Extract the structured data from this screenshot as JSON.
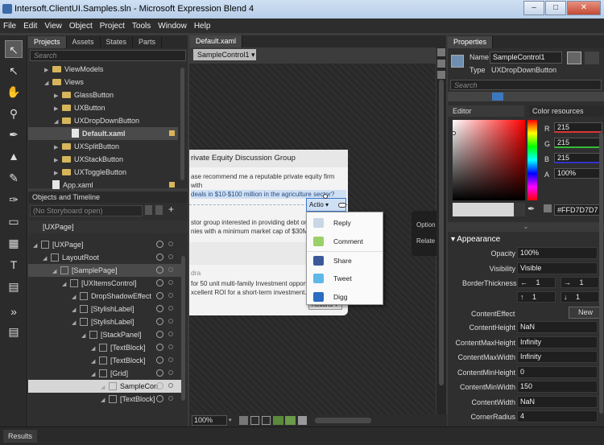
{
  "window": {
    "title": "Intersoft.ClientUI.Samples.sln - Microsoft Expression Blend 4"
  },
  "menu": [
    "File",
    "Edit",
    "View",
    "Object",
    "Project",
    "Tools",
    "Window",
    "Help"
  ],
  "projects_panel": {
    "tabs": [
      "Projects",
      "Assets",
      "States",
      "Parts"
    ],
    "search_placeholder": "Search",
    "tree": [
      {
        "label": "ViewModels",
        "level": 1,
        "kind": "folder",
        "expanded": false
      },
      {
        "label": "Views",
        "level": 1,
        "kind": "folder",
        "expanded": true
      },
      {
        "label": "GlassButton",
        "level": 2,
        "kind": "folder",
        "expanded": false
      },
      {
        "label": "UXButton",
        "level": 2,
        "kind": "folder",
        "expanded": false
      },
      {
        "label": "UXDropDownButton",
        "level": 2,
        "kind": "folder",
        "expanded": true
      },
      {
        "label": "Default.xaml",
        "level": 3,
        "kind": "file",
        "selected": true
      },
      {
        "label": "UXSplitButton",
        "level": 2,
        "kind": "folder",
        "expanded": false
      },
      {
        "label": "UXStackButton",
        "level": 2,
        "kind": "folder",
        "expanded": false
      },
      {
        "label": "UXToggleButton",
        "level": 2,
        "kind": "folder",
        "expanded": false
      },
      {
        "label": "App.xaml",
        "level": 1,
        "kind": "file"
      }
    ]
  },
  "objects_panel": {
    "title": "Objects and Timeline",
    "storyboard": "(No Storyboard open)",
    "root": "[UXPage]",
    "tree": [
      {
        "label": "[UXPage]",
        "level": 0
      },
      {
        "label": "LayoutRoot",
        "level": 1
      },
      {
        "label": "[SamplePage]",
        "level": 2,
        "highlight": true
      },
      {
        "label": "[UXItemsControl]",
        "level": 3
      },
      {
        "label": "DropShadowEffect",
        "level": 4
      },
      {
        "label": "[StylishLabel]",
        "level": 4
      },
      {
        "label": "[StylishLabel]",
        "level": 4
      },
      {
        "label": "[StackPanel]",
        "level": 5
      },
      {
        "label": "[TextBlock]",
        "level": 6
      },
      {
        "label": "[TextBlock]",
        "level": 6
      },
      {
        "label": "[Grid]",
        "level": 6
      },
      {
        "label": "SampleCon",
        "level": 7,
        "selected": true
      },
      {
        "label": "[TextBlock]",
        "level": 7
      }
    ]
  },
  "document": {
    "tab": "Default.xaml",
    "breadcrumb": "SampleControl1",
    "zoom": "100%",
    "card": {
      "title": "rivate Equity Discussion Group",
      "post1_line1": "ase recommend me a reputable private equity firm with",
      "post1_line2": "deals in $10-$100 million in the agriculture sector?",
      "post2_line1": "stor group interested in providing debt or eq",
      "post2_line2": "nies with a minimum market cap of $30M. V",
      "post3_author": "dra",
      "post3_line1": "for 50 unit multi-family Investment opportu",
      "post3_line2": "xcellent ROI for a short-term investment. Pl",
      "actions_label": "Actions",
      "actions_label_top": "Actio"
    },
    "dropdown_items": [
      "Reply",
      "Comment",
      "Share",
      "Tweet",
      "Digg"
    ],
    "side_card": [
      "Option",
      "Relate"
    ]
  },
  "properties": {
    "tab": "Properties",
    "name_label": "Name",
    "name_value": "SampleControl1",
    "type_label": "Type",
    "type_value": "UXDropDownButton",
    "search_placeholder": "Search",
    "editor_tab": "Editor",
    "color_tab": "Color resources",
    "R": "215",
    "G": "215",
    "B": "215",
    "A": "100%",
    "hex": "#FFD7D7D7",
    "section": "Appearance",
    "rows": [
      {
        "label": "Opacity",
        "value": "100%"
      },
      {
        "label": "Visibility",
        "value": "Visible"
      }
    ],
    "thickness_label": "BorderThickness",
    "thickness": [
      "1",
      "1",
      "1",
      "1"
    ],
    "content_effect_label": "ContentEffect",
    "content_effect_btn": "New",
    "rows2": [
      {
        "label": "ContentHeight",
        "value": "NaN"
      },
      {
        "label": "ContentMaxHeight",
        "value": "Infinity"
      },
      {
        "label": "ContentMaxWidth",
        "value": "Infinity"
      },
      {
        "label": "ContentMinHeight",
        "value": "0"
      },
      {
        "label": "ContentMinWidth",
        "value": "150"
      },
      {
        "label": "ContentWidth",
        "value": "NaN"
      },
      {
        "label": "CornerRadius",
        "value": "4"
      }
    ]
  },
  "status": {
    "results": "Results"
  }
}
